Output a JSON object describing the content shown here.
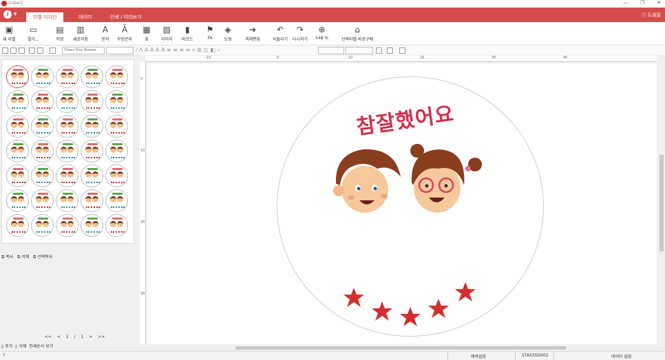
{
  "window": {
    "title": "iLabel2",
    "min": "—",
    "restore": "❐",
    "close": "✕"
  },
  "menubar": {
    "app_icon": "i",
    "tabs": [
      "라벨 디자인",
      "데이터",
      "인쇄 / 미리보기"
    ],
    "help": "도움말"
  },
  "ribbon": {
    "items": [
      "새 라벨",
      "열기...",
      "저장",
      "새로저장",
      "문자",
      "꾸밈문자",
      "표",
      "이미지",
      "바코드",
      "FA",
      "도형",
      "객체편집",
      "되돌리기",
      "다시하기",
      "548 %",
      "선택라벨 바로구매"
    ],
    "icons": [
      "new-doc",
      "folder",
      "disk",
      "disk-plus",
      "A",
      "A-deco",
      "grid",
      "image",
      "barcode",
      "fa",
      "shapes",
      "arrow",
      "undo",
      "redo",
      "zoom",
      "basket"
    ]
  },
  "toolbar2": {
    "font": "Times New Roman",
    "size": ""
  },
  "panel": {
    "copy": "복사",
    "delete": "삭제",
    "select_copy": "선택복사",
    "pager": "<< < 1 / 1 > >>",
    "add": "추가",
    "delete2": "삭제",
    "print_order": "인쇄순서 보기"
  },
  "canvas": {
    "ruler_h": [
      "-10",
      "0",
      "10",
      "20",
      "30",
      "40"
    ],
    "ruler_v": [
      "0",
      "10",
      "20",
      "30"
    ],
    "headline": "참잘했어요"
  },
  "status": {
    "left": "?",
    "a": "제목없음",
    "b": "STA535D002",
    "c": "데이터 없음"
  },
  "colors": {
    "accent": "#d54b4b",
    "headline": "#d32f4e",
    "star": "#d32f2f"
  }
}
